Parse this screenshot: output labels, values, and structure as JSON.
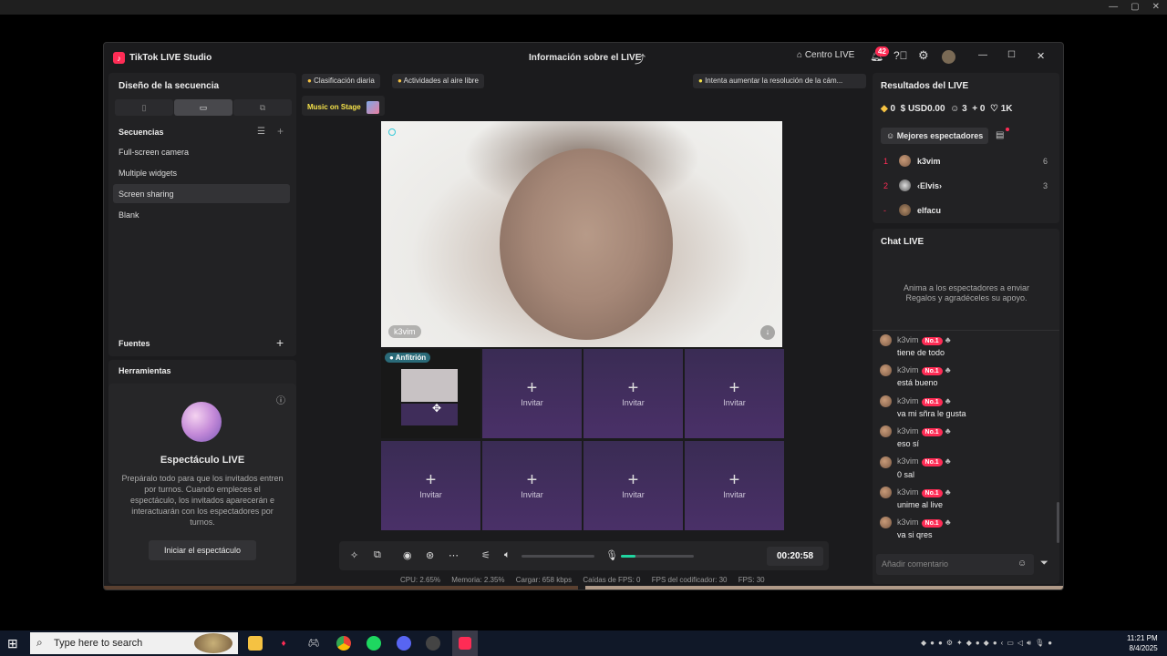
{
  "app": {
    "logo_glyph": "♪",
    "title": "TikTok LIVE Studio",
    "center_title": "Información sobre el LIVE",
    "live_center_label": "Centro LIVE",
    "notification_count": "42"
  },
  "sidebar": {
    "layout_title": "Diseño de la secuencia",
    "sequences_title": "Secuencias",
    "sequences": [
      "Full-screen camera",
      "Multiple widgets",
      "Screen sharing",
      "Blank"
    ],
    "selected_sequence": "Screen sharing",
    "sources_title": "Fuentes",
    "tools_title": "Herramientas",
    "show_title": "Espectáculo LIVE",
    "show_desc": "Prepáralo todo para que los invitados entren por turnos. Cuando empleces el espectáculo, los invitados aparecerán e interactuarán con los espectadores por turnos.",
    "show_button": "Iniciar el espectáculo"
  },
  "top_chips": {
    "daily_rank": "Clasificación diaria",
    "outdoor": "Actividades al aire libre",
    "hint": "Intenta aumentar la resolución de la cám...",
    "music": "Music on Stage"
  },
  "stage": {
    "main_name": "k3vim",
    "host_label": "Anfitrión",
    "invite_label": "Invitar",
    "invite_plus": "+"
  },
  "controls": {
    "timer": "00:20:58",
    "volume_level": 0,
    "mic_level": 0.2
  },
  "stats": {
    "cpu": "CPU:  2.65%",
    "memory": "Memoria:  2.35%",
    "upload": "Cargar:  658 kbps",
    "fps_drops": "Caídas de FPS:  0",
    "encoder_fps": "FPS del codificador:  30",
    "fps": "FPS:  30"
  },
  "results": {
    "title": "Resultados del LIVE",
    "diamonds": "0",
    "usd": "USD0.00",
    "viewers": "3",
    "new_followers": "0",
    "likes": "1K",
    "top_viewers_label": "Mejores espectadores",
    "ranking": [
      {
        "rank": "1",
        "name": "k3vim",
        "score": "6"
      },
      {
        "rank": "2",
        "name": "‹Elvis›",
        "score": "3"
      },
      {
        "rank": "-",
        "name": "elfacu",
        "score": ""
      }
    ]
  },
  "chat": {
    "title": "Chat LIVE",
    "empty_hint": "Anima a los espectadores a enviar Regalos y agradéceles su apoyo.",
    "badge": "No.1",
    "messages": [
      {
        "user": "k3vim",
        "text": "tiene de todo"
      },
      {
        "user": "k3vim",
        "text": "está bueno"
      },
      {
        "user": "k3vim",
        "text": "va mi sñra le gusta"
      },
      {
        "user": "k3vim",
        "text": "eso sí"
      },
      {
        "user": "k3vim",
        "text": "0 sal"
      },
      {
        "user": "k3vim",
        "text": "unime al live"
      },
      {
        "user": "k3vim",
        "text": "va si qres"
      }
    ],
    "input_placeholder": "Añadir comentario"
  },
  "taskbar": {
    "search_placeholder": "Type here to search",
    "time": "11:21 PM",
    "date": "8/4/2025"
  },
  "colors": {
    "accent": "#fe2c55",
    "teal": "#20d5a0",
    "invite_cell": "#3f2d5a"
  }
}
